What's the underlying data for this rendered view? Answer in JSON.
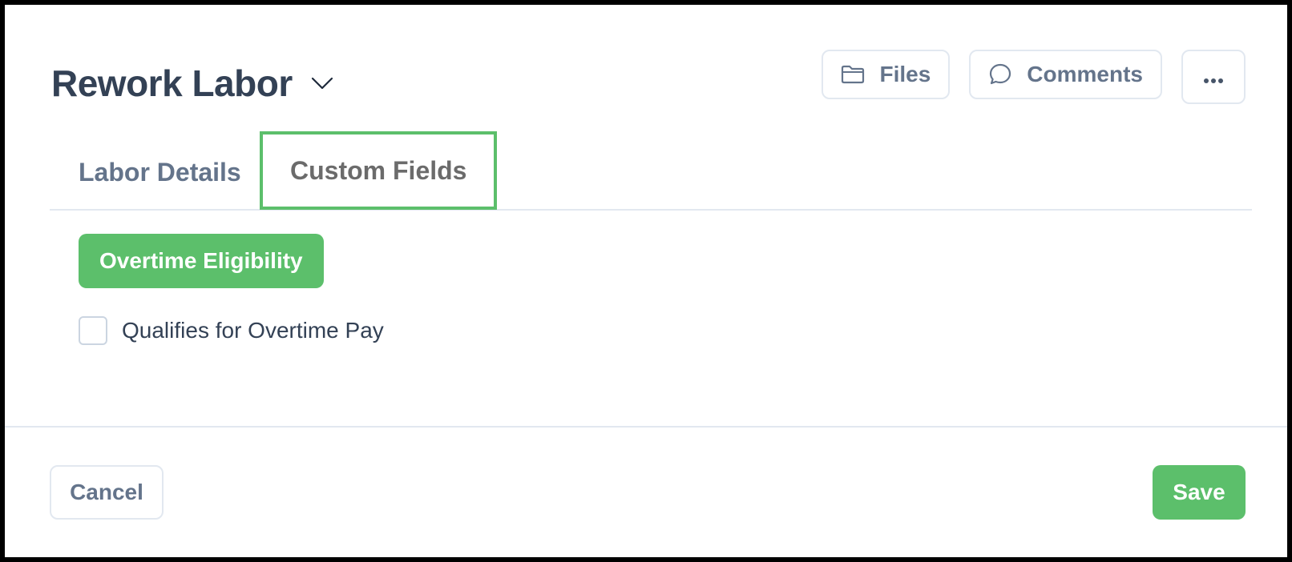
{
  "header": {
    "title": "Rework Labor",
    "files_label": "Files",
    "comments_label": "Comments"
  },
  "tabs": [
    {
      "label": "Labor Details",
      "active": false
    },
    {
      "label": "Custom Fields",
      "active": true
    }
  ],
  "section": {
    "title": "Overtime Eligibility"
  },
  "fields": {
    "overtime_checkbox_label": "Qualifies for Overtime Pay",
    "overtime_checked": false
  },
  "footer": {
    "cancel_label": "Cancel",
    "save_label": "Save"
  },
  "icons": {
    "title_dropdown": "chevron-down-icon",
    "files": "folder-icon",
    "comments": "speech-bubble-icon",
    "more": "ellipsis-icon"
  },
  "colors": {
    "accent": "#5cbf6b",
    "title_text": "#334155",
    "muted_text": "#64748b",
    "border": "#e2e8f0"
  }
}
